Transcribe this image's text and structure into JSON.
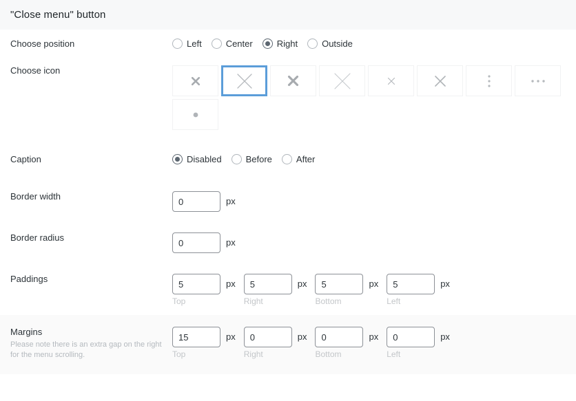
{
  "header": {
    "title": "\"Close menu\" button"
  },
  "rows": {
    "position": {
      "label": "Choose position",
      "options": [
        {
          "label": "Left",
          "checked": false
        },
        {
          "label": "Center",
          "checked": false
        },
        {
          "label": "Right",
          "checked": true
        },
        {
          "label": "Outside",
          "checked": false
        }
      ]
    },
    "icon": {
      "label": "Choose icon",
      "selected_index": 1,
      "icons": [
        {
          "name": "close-x-bold-small-icon",
          "selected": false
        },
        {
          "name": "close-x-thin-large-icon",
          "selected": true
        },
        {
          "name": "close-x-bold-medium-icon",
          "selected": false
        },
        {
          "name": "close-x-thin-xlarge-icon",
          "selected": false
        },
        {
          "name": "close-x-thin-small-icon",
          "selected": false
        },
        {
          "name": "close-x-thin-medium-icon",
          "selected": false
        },
        {
          "name": "kebab-vertical-dots-icon",
          "selected": false
        },
        {
          "name": "horizontal-ellipsis-icon",
          "selected": false
        },
        {
          "name": "single-dot-icon",
          "selected": false
        }
      ]
    },
    "caption": {
      "label": "Caption",
      "options": [
        {
          "label": "Disabled",
          "checked": true
        },
        {
          "label": "Before",
          "checked": false
        },
        {
          "label": "After",
          "checked": false
        }
      ]
    },
    "border_width": {
      "label": "Border width",
      "value": "0",
      "unit": "px"
    },
    "border_radius": {
      "label": "Border radius",
      "value": "0",
      "unit": "px"
    },
    "paddings": {
      "label": "Paddings",
      "fields": [
        {
          "value": "5",
          "unit": "px",
          "sub": "Top"
        },
        {
          "value": "5",
          "unit": "px",
          "sub": "Right"
        },
        {
          "value": "5",
          "unit": "px",
          "sub": "Bottom"
        },
        {
          "value": "5",
          "unit": "px",
          "sub": "Left"
        }
      ]
    },
    "margins": {
      "label": "Margins",
      "hint": "Please note there is an extra gap on the right for the menu scrolling.",
      "fields": [
        {
          "value": "15",
          "unit": "px",
          "sub": "Top"
        },
        {
          "value": "0",
          "unit": "px",
          "sub": "Right"
        },
        {
          "value": "0",
          "unit": "px",
          "sub": "Bottom"
        },
        {
          "value": "0",
          "unit": "px",
          "sub": "Left"
        }
      ]
    }
  },
  "colors": {
    "accent_selected": "#5b9dd9",
    "header_bg": "#f7f8f9",
    "striped_bg": "#fafafa",
    "text": "#2c3338",
    "muted": "#b4b9be"
  }
}
